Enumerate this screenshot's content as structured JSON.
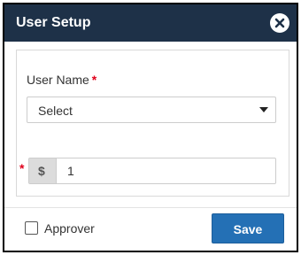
{
  "dialog": {
    "title": "User Setup",
    "close_icon": "close-circle-icon"
  },
  "form": {
    "user_name": {
      "label": "User Name",
      "required_mark": "*",
      "selected_value": "Select",
      "caret_icon": "caret-down-icon"
    },
    "amount": {
      "required_mark": "*",
      "currency_symbol": "$",
      "value": "1"
    }
  },
  "footer": {
    "approver_label": "Approver",
    "approver_checked": false,
    "save_label": "Save"
  },
  "colors": {
    "header_bg": "#1e3148",
    "required": "#e0001b",
    "save_button": "#2470b5"
  }
}
